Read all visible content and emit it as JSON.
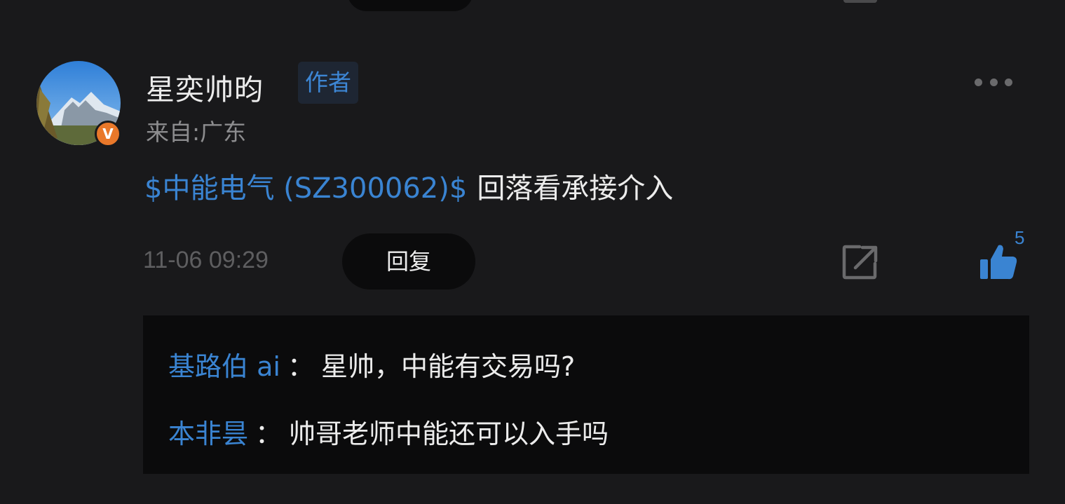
{
  "comment": {
    "username": "星奕帅昀",
    "author_badge": "作者",
    "location": "来自:广东",
    "stock_link": "$中能电气 (SZ300062)$",
    "text": "回落看承接介入",
    "timestamp": "11-06 09:29",
    "reply_label": "回复",
    "like_count": "5",
    "verified_badge": "V"
  },
  "replies": [
    {
      "author": "基路伯 ai",
      "separator": "：",
      "text": "星帅，中能有交易吗?"
    },
    {
      "author": "本非昙",
      "separator": "：",
      "text": "帅哥老师中能还可以入手吗"
    }
  ],
  "icons": {
    "more": "more-dots-icon",
    "share": "share-icon",
    "like": "thumbs-up-icon"
  },
  "colors": {
    "background": "#19191b",
    "accent": "#3a84d2",
    "badge": "#e9782a",
    "reply_bg": "#0b0b0c"
  }
}
